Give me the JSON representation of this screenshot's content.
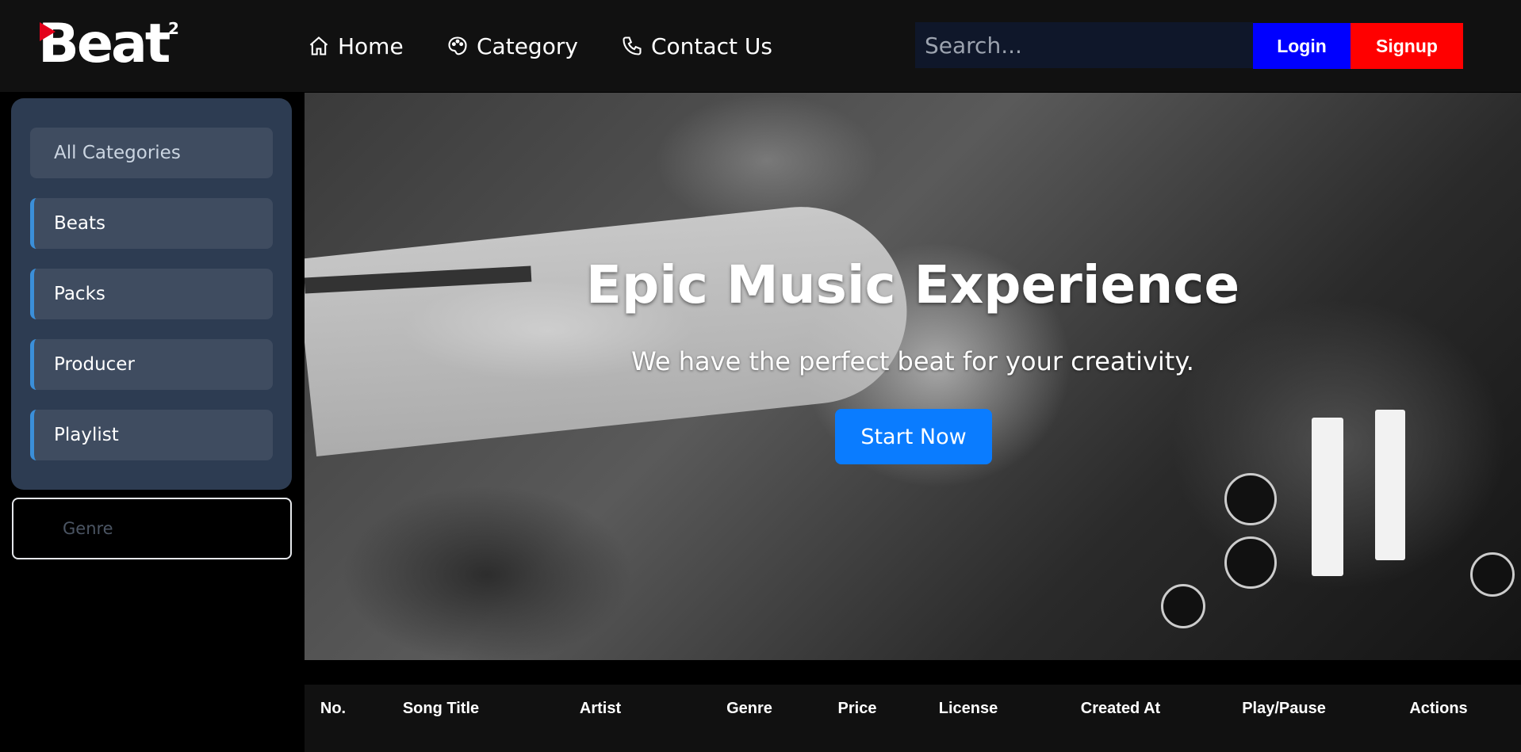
{
  "header": {
    "logo": {
      "text": "Beat",
      "sup": "2"
    },
    "nav": [
      {
        "label": "Home",
        "icon": "home-icon"
      },
      {
        "label": "Category",
        "icon": "palette-icon"
      },
      {
        "label": "Contact Us",
        "icon": "phone-icon"
      }
    ],
    "search_placeholder": "Search...",
    "login_label": "Login",
    "signup_label": "Signup"
  },
  "sidebar": {
    "categories": [
      {
        "label": "All Categories"
      },
      {
        "label": "Beats"
      },
      {
        "label": "Packs"
      },
      {
        "label": "Producer"
      },
      {
        "label": "Playlist"
      }
    ],
    "genre_placeholder": "Genre"
  },
  "hero": {
    "title": "Epic Music Experience",
    "subtitle": "We have the perfect beat for your creativity.",
    "cta_label": "Start Now"
  },
  "table": {
    "headers": [
      "No.",
      "Song Title",
      "Artist",
      "Genre",
      "Price",
      "License",
      "Created At",
      "Play/Pause",
      "Actions"
    ]
  },
  "colors": {
    "login": "#0000ff",
    "signup": "#ff0000",
    "cta": "#0a7cff",
    "sidebar": "#2d3c52",
    "category_accent": "#3b8fd9"
  }
}
